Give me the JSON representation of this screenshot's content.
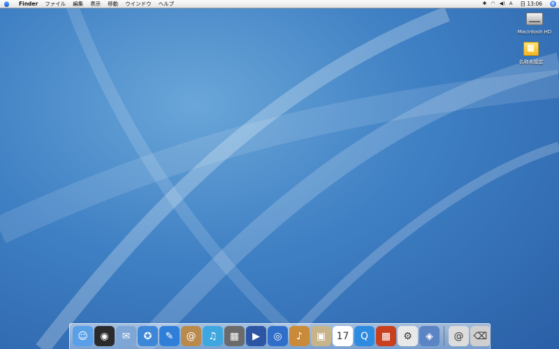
{
  "menubar": {
    "app_name": "Finder",
    "menus": [
      "ファイル",
      "編集",
      "表示",
      "移動",
      "ウインドウ",
      "ヘルプ"
    ],
    "clock": "日 13:06"
  },
  "desktop_icons": [
    {
      "label": "Macintosh HD",
      "icon": "hard-drive-icon"
    },
    {
      "label": "名称未設定",
      "icon": "folder-icon"
    }
  ],
  "dock": {
    "apps": [
      {
        "name": "finder-icon",
        "glyph": "☺",
        "bg": "#5aa0e8"
      },
      {
        "name": "dashboard-icon",
        "glyph": "◉",
        "bg": "#2b2b2b"
      },
      {
        "name": "mail-icon",
        "glyph": "✉",
        "bg": "#7fa7d6"
      },
      {
        "name": "safari-icon",
        "glyph": "✪",
        "bg": "#3d87d9"
      },
      {
        "name": "ichat-icon",
        "glyph": "✎",
        "bg": "#2f7fd9"
      },
      {
        "name": "address-book-icon",
        "glyph": "@",
        "bg": "#b98a4b"
      },
      {
        "name": "itunes-icon",
        "glyph": "♫",
        "bg": "#3fa7e0"
      },
      {
        "name": "iphoto-icon",
        "glyph": "▦",
        "bg": "#6b6b6b"
      },
      {
        "name": "imovie-icon",
        "glyph": "▶",
        "bg": "#2c56a4"
      },
      {
        "name": "idvd-icon",
        "glyph": "◎",
        "bg": "#2f6fc9"
      },
      {
        "name": "garageband-icon",
        "glyph": "♪",
        "bg": "#c98a3a"
      },
      {
        "name": "iweb-icon",
        "glyph": "▣",
        "bg": "#c7b48a"
      },
      {
        "name": "ical-icon",
        "glyph": "17",
        "bg": "#ffffff"
      },
      {
        "name": "quicktime-icon",
        "glyph": "Q",
        "bg": "#2d8be0"
      },
      {
        "name": "photo-booth-icon",
        "glyph": "▩",
        "bg": "#c9401e"
      },
      {
        "name": "system-preferences-icon",
        "glyph": "⚙",
        "bg": "#e8e8e8"
      },
      {
        "name": "preview-icon",
        "glyph": "◈",
        "bg": "#5b84c4"
      }
    ],
    "extras": [
      {
        "name": "internet-location-icon",
        "glyph": "@",
        "bg": "#dcdcdc"
      },
      {
        "name": "trash-icon",
        "glyph": "⌫",
        "bg": "#cfcfcf"
      }
    ]
  }
}
